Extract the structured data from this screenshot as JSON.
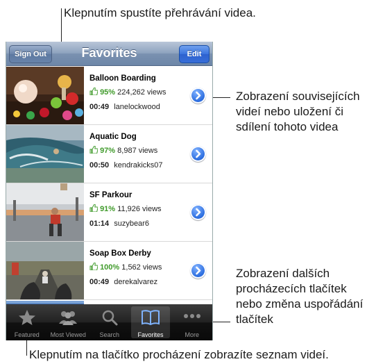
{
  "callouts": {
    "top": "Klepnutím spustíte přehrávání videa.",
    "right_top": [
      "Zobrazení souvisejících",
      "videí nebo uložení či",
      "sdílení tohoto videa"
    ],
    "right_bottom": [
      "Zobrazení dalších",
      "procházecích tlačítek",
      "nebo změna uspořádání",
      "tlačítek"
    ],
    "bottom": "Klepnutím na tlačítko procházení zobrazíte seznam videí."
  },
  "navbar": {
    "title": "Favorites",
    "left_button": "Sign Out",
    "right_button": "Edit"
  },
  "videos": [
    {
      "title": "Balloon Boarding",
      "rating": "95%",
      "views": "224,262 views",
      "duration": "00:49",
      "author": "lanelockwood"
    },
    {
      "title": "Aquatic Dog",
      "rating": "97%",
      "views": "8,987 views",
      "duration": "00:50",
      "author": "kendrakicks07"
    },
    {
      "title": "SF Parkour",
      "rating": "91%",
      "views": "11,926 views",
      "duration": "01:14",
      "author": "suzybear6"
    },
    {
      "title": "Soap Box Derby",
      "rating": "100%",
      "views": "1,562 views",
      "duration": "00:49",
      "author": "derekalvarez"
    }
  ],
  "tabs": [
    {
      "label": "Featured",
      "icon": "star-icon",
      "selected": false
    },
    {
      "label": "Most Viewed",
      "icon": "people-icon",
      "selected": false
    },
    {
      "label": "Search",
      "icon": "search-icon",
      "selected": false
    },
    {
      "label": "Favorites",
      "icon": "book-icon",
      "selected": true
    },
    {
      "label": "More",
      "icon": "more-dots-icon",
      "selected": false
    }
  ],
  "colors": {
    "navbar": "#7a91b0",
    "edit_button": "#3a73de",
    "rating_green": "#3f9a2a",
    "disclosure_blue": "#2e6fe0",
    "tabbar": "#1a1a1a"
  }
}
